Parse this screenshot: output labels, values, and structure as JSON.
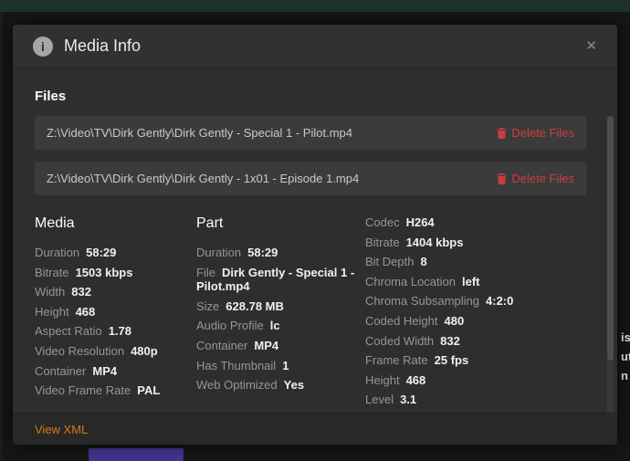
{
  "modal": {
    "title": "Media Info",
    "info_glyph": "i",
    "close_glyph": "✕",
    "files": {
      "heading": "Files",
      "delete_label": "Delete Files",
      "rows": [
        {
          "path": "Z:\\Video\\TV\\Dirk Gently\\Dirk Gently - Special 1 - Pilot.mp4"
        },
        {
          "path": "Z:\\Video\\TV\\Dirk Gently\\Dirk Gently - 1x01 - Episode 1.mp4"
        }
      ]
    },
    "columns": [
      {
        "heading": "Media",
        "fields": [
          {
            "label": "Duration",
            "value": "58:29"
          },
          {
            "label": "Bitrate",
            "value": "1503 kbps"
          },
          {
            "label": "Width",
            "value": "832"
          },
          {
            "label": "Height",
            "value": "468"
          },
          {
            "label": "Aspect Ratio",
            "value": "1.78"
          },
          {
            "label": "Video Resolution",
            "value": "480p"
          },
          {
            "label": "Container",
            "value": "MP4"
          },
          {
            "label": "Video Frame Rate",
            "value": "PAL"
          }
        ]
      },
      {
        "heading": "Part",
        "fields": [
          {
            "label": "Duration",
            "value": "58:29"
          },
          {
            "label": "File",
            "value": "Dirk Gently - Special 1 - Pilot.mp4"
          },
          {
            "label": "Size",
            "value": "628.78 MB"
          },
          {
            "label": "Audio Profile",
            "value": "lc"
          },
          {
            "label": "Container",
            "value": "MP4"
          },
          {
            "label": "Has Thumbnail",
            "value": "1"
          },
          {
            "label": "Web Optimized",
            "value": "Yes"
          }
        ]
      },
      {
        "heading": "",
        "fields": [
          {
            "label": "Codec",
            "value": "H264"
          },
          {
            "label": "Bitrate",
            "value": "1404 kbps"
          },
          {
            "label": "Bit Depth",
            "value": "8"
          },
          {
            "label": "Chroma Location",
            "value": "left"
          },
          {
            "label": "Chroma Subsampling",
            "value": "4:2:0"
          },
          {
            "label": "Coded Height",
            "value": "480"
          },
          {
            "label": "Coded Width",
            "value": "832"
          },
          {
            "label": "Frame Rate",
            "value": "25 fps"
          },
          {
            "label": "Height",
            "value": "468"
          },
          {
            "label": "Level",
            "value": "3.1"
          }
        ]
      }
    ],
    "footer": {
      "view_xml_label": "View XML"
    }
  },
  "colors": {
    "delete_red": "#cc3d3d",
    "link_orange": "#cc7b19",
    "top_bar_teal": "#1d332d"
  },
  "background": {
    "fragments": [
      "is",
      "ut",
      "n"
    ]
  }
}
